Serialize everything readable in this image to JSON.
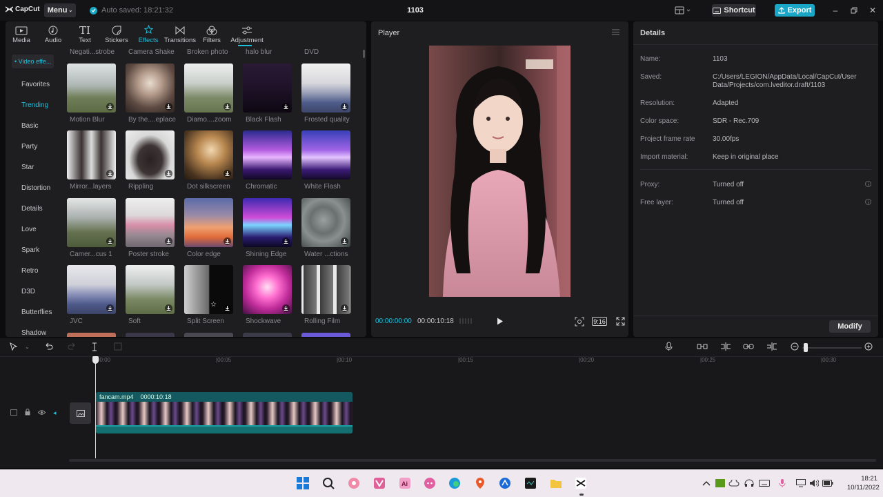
{
  "app": {
    "logo": "CapCut",
    "menu_label": "Menu",
    "autosave": "Auto saved: 18:21:32",
    "project_title": "1103",
    "shortcut_label": "Shortcut",
    "export_label": "Export",
    "accent_color": "#1ec0dc"
  },
  "toolbar": {
    "tabs": [
      {
        "label": "Media",
        "icon": "media-icon"
      },
      {
        "label": "Audio",
        "icon": "audio-icon"
      },
      {
        "label": "Text",
        "icon": "text-icon"
      },
      {
        "label": "Stickers",
        "icon": "stickers-icon"
      },
      {
        "label": "Effects",
        "icon": "effects-icon",
        "active": true
      },
      {
        "label": "Transitions",
        "icon": "transitions-icon"
      },
      {
        "label": "Filters",
        "icon": "filters-icon"
      },
      {
        "label": "Adjustment",
        "icon": "adjustment-icon"
      }
    ]
  },
  "sidebar": {
    "selected": "• Video effe...",
    "categories": [
      "Favorites",
      "Trending",
      "Basic",
      "Party",
      "Star",
      "Distortion",
      "Details",
      "Love",
      "Spark",
      "Retro",
      "D3D",
      "Butterflies",
      "Shadow"
    ],
    "active": "Trending"
  },
  "effects": {
    "top_row_labels": [
      "Negati...strobe",
      "Camera Shake",
      "Broken photo",
      "halo blur",
      "DVD"
    ],
    "rows": [
      [
        "Motion Blur",
        "By the....eplace",
        "Diamo....zoom",
        "Black Flash",
        "Frosted quality"
      ],
      [
        "Mirror...layers",
        "Rippling",
        "Dot silkscreen",
        "Chromatic",
        "White Flash"
      ],
      [
        "Camer...cus 1",
        "Poster stroke",
        "Color edge",
        "Shining Edge",
        "Water ...ctions"
      ],
      [
        "JVC",
        "Soft",
        "Split Screen",
        "Shockwave",
        "Rolling Film"
      ]
    ]
  },
  "player": {
    "title": "Player",
    "current_time": "00:00:00:00",
    "total_time": "00:00:10:18",
    "ratio": "9:16"
  },
  "details": {
    "title": "Details",
    "fields": [
      {
        "key": "Name:",
        "value": "1103"
      },
      {
        "key": "Saved:",
        "value": "C:/Users/LEGION/AppData/Local/CapCut/User Data/Projects/com.lveditor.draft/1103"
      },
      {
        "key": "Resolution:",
        "value": "Adapted"
      },
      {
        "key": "Color space:",
        "value": "SDR - Rec.709"
      },
      {
        "key": "Project frame rate",
        "value": "30.00fps"
      },
      {
        "key": "Import material:",
        "value": "Keep in original place"
      }
    ],
    "extra_fields": [
      {
        "key": "Proxy:",
        "value": "Turned off"
      },
      {
        "key": "Free layer:",
        "value": "Turned off"
      }
    ],
    "modify_label": "Modify"
  },
  "timeline": {
    "ruler": [
      "00:00",
      "|00:05",
      "|00:10",
      "|00:15",
      "|00:20",
      "|00:25",
      "|00:30"
    ],
    "clip_name": "fancam.mp4",
    "clip_duration": "0000:10:18"
  },
  "taskbar": {
    "time": "18:21",
    "date": "10/11/2022"
  }
}
